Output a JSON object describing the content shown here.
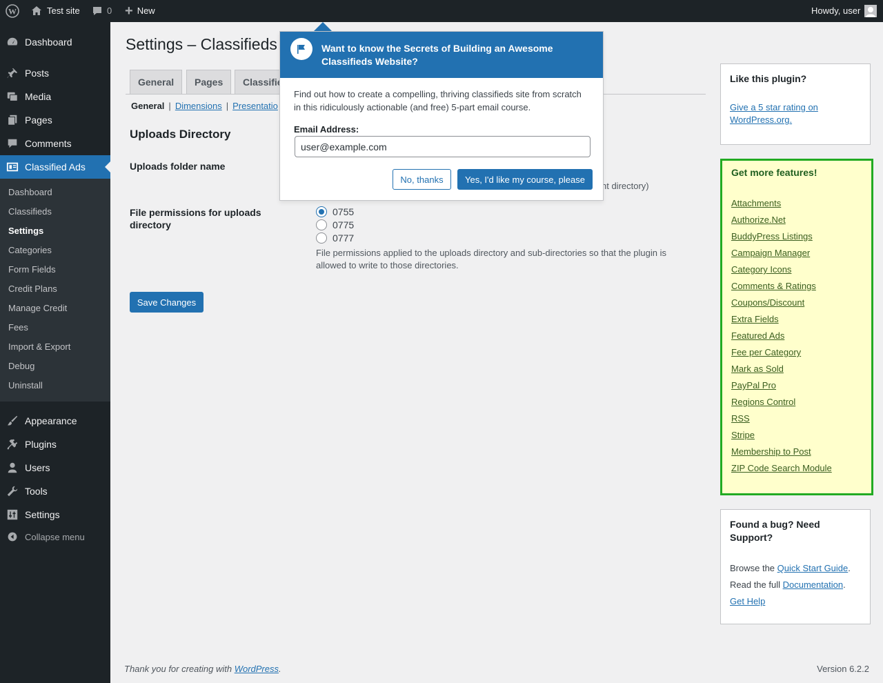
{
  "adminbar": {
    "site_name": "Test site",
    "comments_count": "0",
    "new_label": "New",
    "howdy": "Howdy, user"
  },
  "sidebar": {
    "items_top": [
      {
        "label": "Dashboard",
        "icon": "dashboard-icon"
      },
      {
        "label": "Posts",
        "icon": "pin-icon"
      },
      {
        "label": "Media",
        "icon": "media-icon"
      },
      {
        "label": "Pages",
        "icon": "pages-icon"
      },
      {
        "label": "Comments",
        "icon": "comments-icon"
      },
      {
        "label": "Classified Ads",
        "icon": "classified-icon"
      }
    ],
    "submenu": [
      "Dashboard",
      "Classifieds",
      "Settings",
      "Categories",
      "Form Fields",
      "Credit Plans",
      "Manage Credit",
      "Fees",
      "Import & Export",
      "Debug",
      "Uninstall"
    ],
    "items_bottom": [
      {
        "label": "Appearance",
        "icon": "brush-icon"
      },
      {
        "label": "Plugins",
        "icon": "plugin-icon"
      },
      {
        "label": "Users",
        "icon": "users-icon"
      },
      {
        "label": "Tools",
        "icon": "wrench-icon"
      },
      {
        "label": "Settings",
        "icon": "settings-icon"
      }
    ],
    "collapse": "Collapse menu"
  },
  "main": {
    "title": "Settings – Classifieds",
    "tabs": [
      "General",
      "Pages",
      "Classifie"
    ],
    "subnav": {
      "current": "General",
      "links": [
        "Dimensions",
        "Presentatio"
      ]
    },
    "section_title": "Uploads Directory",
    "uploads_folder_label": "Uploads folder name",
    "uploads_folder_partial_desc": "nt directory)",
    "permissions_label": "File permissions for uploads directory",
    "permissions_options": [
      "0755",
      "0775",
      "0777"
    ],
    "permissions_selected": "0755",
    "permissions_desc": "File permissions applied to the uploads directory and sub-directories so that the plugin is allowed to write to those directories.",
    "save_label": "Save Changes"
  },
  "popup": {
    "title": "Want to know the Secrets of Building an Awesome Classifieds Website?",
    "body": "Find out how to create a compelling, thriving classifieds site from scratch in this ridiculously actionable (and free) 5-part email course.",
    "email_label": "Email Address:",
    "email_value": "user@example.com",
    "no_label": "No, thanks",
    "yes_label": "Yes, I'd like my course, please"
  },
  "right": {
    "like_title": "Like this plugin?",
    "like_link": "Give a 5 star rating on WordPress.org.",
    "features_title": "Get more features!",
    "features": [
      "Attachments",
      "Authorize.Net",
      "BuddyPress Listings",
      "Campaign Manager",
      "Category Icons",
      "Comments & Ratings",
      "Coupons/Discount",
      "Extra Fields",
      "Featured Ads",
      "Fee per Category",
      "Mark as Sold",
      "PayPal Pro",
      "Regions Control",
      "RSS",
      "Stripe",
      "Membership to Post",
      "ZIP Code Search Module"
    ],
    "bug_title": "Found a bug? Need Support?",
    "browse_prefix": "Browse the ",
    "quick_start": "Quick Start Guide",
    "read_prefix": "Read the full ",
    "documentation": "Documentation",
    "period": ".",
    "get_help": "Get Help"
  },
  "footer": {
    "thanks_prefix": "Thank you for creating with ",
    "wordpress": "WordPress",
    "period": ".",
    "version": "Version 6.2.2"
  },
  "colors": {
    "accent": "#2271b1",
    "features_border": "#22aa22",
    "features_bg": "#ffffcc",
    "adminbar_bg": "#1d2327"
  }
}
